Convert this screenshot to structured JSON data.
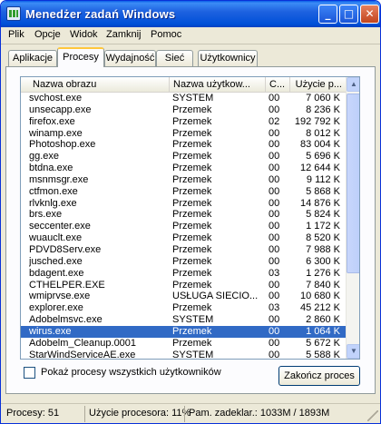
{
  "window": {
    "title": "Menedżer zadań Windows",
    "buttons": {
      "minimize": "_",
      "maximize": "□",
      "close": "✕"
    }
  },
  "menu": [
    "Plik",
    "Opcje",
    "Widok",
    "Zamknij",
    "Pomoc"
  ],
  "tabs": [
    "Aplikacje",
    "Procesy",
    "Wydajność",
    "Sieć",
    "Użytkownicy"
  ],
  "active_tab": "Procesy",
  "table": {
    "headers": [
      "Nazwa obrazu",
      "Nazwa użytkow...",
      "C...",
      "Użycie p..."
    ],
    "rows": [
      [
        "svchost.exe",
        "SYSTEM",
        "00",
        "7 060 K"
      ],
      [
        "unsecapp.exe",
        "Przemek",
        "00",
        "8 236 K"
      ],
      [
        "firefox.exe",
        "Przemek",
        "02",
        "192 792 K"
      ],
      [
        "winamp.exe",
        "Przemek",
        "00",
        "8 012 K"
      ],
      [
        "Photoshop.exe",
        "Przemek",
        "00",
        "83 004 K"
      ],
      [
        "gg.exe",
        "Przemek",
        "00",
        "5 696 K"
      ],
      [
        "btdna.exe",
        "Przemek",
        "00",
        "12 644 K"
      ],
      [
        "msnmsgr.exe",
        "Przemek",
        "00",
        "9 112 K"
      ],
      [
        "ctfmon.exe",
        "Przemek",
        "00",
        "5 868 K"
      ],
      [
        "rlvknlg.exe",
        "Przemek",
        "00",
        "14 876 K"
      ],
      [
        "brs.exe",
        "Przemek",
        "00",
        "5 824 K"
      ],
      [
        "seccenter.exe",
        "Przemek",
        "00",
        "1 172 K"
      ],
      [
        "wuauclt.exe",
        "Przemek",
        "00",
        "8 520 K"
      ],
      [
        "PDVD8Serv.exe",
        "Przemek",
        "00",
        "7 988 K"
      ],
      [
        "jusched.exe",
        "Przemek",
        "00",
        "6 300 K"
      ],
      [
        "bdagent.exe",
        "Przemek",
        "03",
        "1 276 K"
      ],
      [
        "CTHELPER.EXE",
        "Przemek",
        "00",
        "7 840 K"
      ],
      [
        "wmiprvse.exe",
        "USŁUGA SIECIO...",
        "00",
        "10 680 K"
      ],
      [
        "explorer.exe",
        "Przemek",
        "03",
        "45 212 K"
      ],
      [
        "Adobelmsvc.exe",
        "SYSTEM",
        "00",
        "2 860 K"
      ],
      [
        "wirus.exe",
        "Przemek",
        "00",
        "1 064 K"
      ],
      [
        "Adobelm_Cleanup.0001",
        "Przemek",
        "00",
        "5 672 K"
      ],
      [
        "StarWindServiceAE.exe",
        "SYSTEM",
        "00",
        "5 588 K"
      ]
    ],
    "selected_index": 20
  },
  "show_all_label": "Pokaż procesy wszystkich użytkowników",
  "end_process_label": "Zakończ proces",
  "status": {
    "processes": "Procesy: 51",
    "cpu": "Użycie procesora: 11%",
    "memory": "Pam. zadeklar.: 1033M / 1893M"
  },
  "icons": [
    "task-manager-icon",
    "minimize-icon",
    "maximize-icon",
    "close-icon",
    "scroll-up-icon",
    "scroll-down-icon",
    "resize-grip-icon"
  ]
}
